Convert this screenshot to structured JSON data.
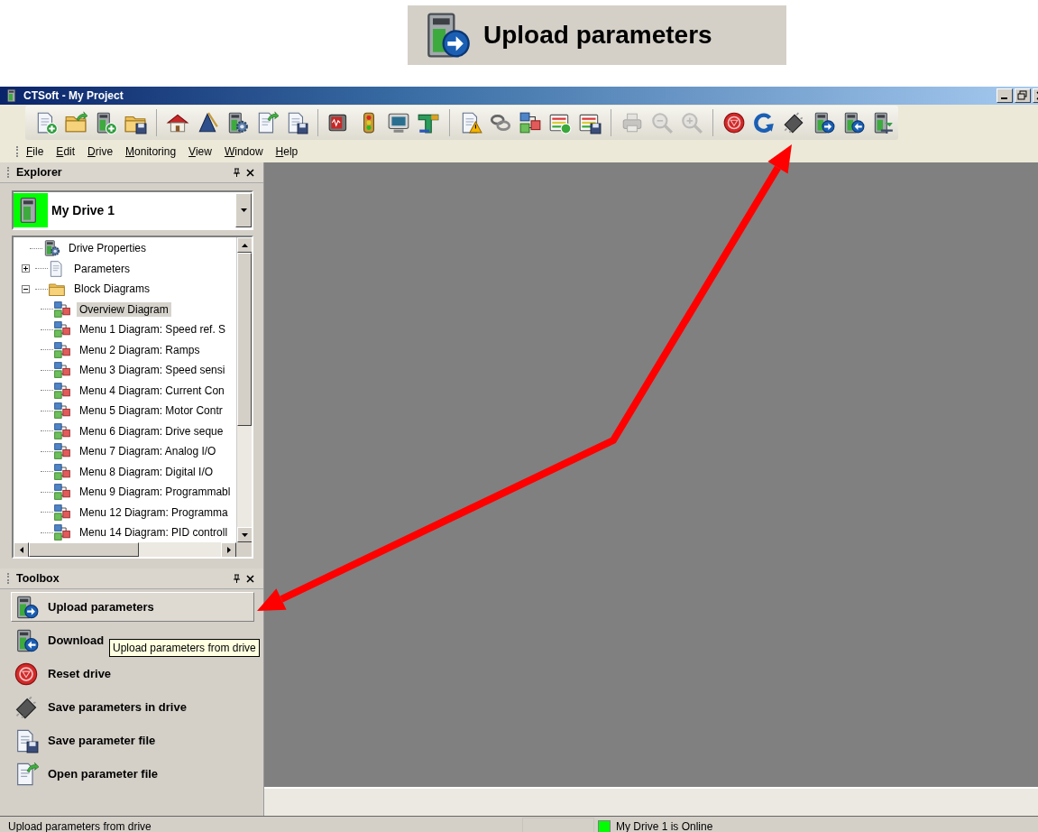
{
  "callout": {
    "text": "Upload parameters"
  },
  "window": {
    "title": "CTSoft - My Project"
  },
  "toolbar": {
    "groups": [
      [
        {
          "disabled": false
        },
        {
          "disabled": false
        },
        {
          "disabled": false
        },
        {
          "disabled": false
        }
      ],
      [
        {
          "disabled": false
        },
        {
          "disabled": false
        },
        {
          "disabled": false
        },
        {
          "disabled": false
        },
        {
          "disabled": false
        }
      ],
      [
        {
          "disabled": false
        },
        {
          "disabled": false
        },
        {
          "disabled": false
        },
        {
          "disabled": false
        }
      ],
      [
        {
          "disabled": false
        },
        {
          "disabled": false
        },
        {
          "disabled": false
        },
        {
          "disabled": false
        },
        {
          "disabled": false
        }
      ],
      [
        {
          "disabled": true
        },
        {
          "disabled": true
        },
        {
          "disabled": true
        }
      ],
      [
        {
          "disabled": false
        },
        {
          "disabled": false
        },
        {
          "disabled": false
        },
        {
          "disabled": false
        },
        {
          "disabled": false
        },
        {
          "disabled": false
        }
      ]
    ]
  },
  "menu": [
    "File",
    "Edit",
    "Drive",
    "Monitoring",
    "View",
    "Window",
    "Help"
  ],
  "explorer": {
    "title": "Explorer",
    "drive_selector": {
      "value": "My Drive 1",
      "online": true
    },
    "tree": [
      {
        "kind": "properties",
        "label": "Drive Properties",
        "selected": false
      },
      {
        "kind": "parameters",
        "label": "Parameters",
        "expanded": false,
        "selected": false
      },
      {
        "kind": "folder",
        "label": "Block Diagrams",
        "expanded": true,
        "selected": false,
        "children": [
          {
            "kind": "diagram",
            "label": "Overview Diagram",
            "selected": true
          },
          {
            "kind": "diagram",
            "label": "Menu 1 Diagram: Speed ref. S",
            "selected": false
          },
          {
            "kind": "diagram",
            "label": "Menu 2 Diagram: Ramps",
            "selected": false
          },
          {
            "kind": "diagram",
            "label": "Menu 3 Diagram: Speed sensi",
            "selected": false
          },
          {
            "kind": "diagram",
            "label": "Menu 4 Diagram: Current Con",
            "selected": false
          },
          {
            "kind": "diagram",
            "label": "Menu 5 Diagram: Motor Contr",
            "selected": false
          },
          {
            "kind": "diagram",
            "label": "Menu 6 Diagram: Drive seque",
            "selected": false
          },
          {
            "kind": "diagram",
            "label": "Menu 7 Diagram: Analog I/O",
            "selected": false
          },
          {
            "kind": "diagram",
            "label": "Menu 8 Diagram: Digital I/O",
            "selected": false
          },
          {
            "kind": "diagram",
            "label": "Menu 9 Diagram: Programmabl",
            "selected": false
          },
          {
            "kind": "diagram",
            "label": "Menu 12 Diagram: Programma",
            "selected": false
          },
          {
            "kind": "diagram",
            "label": "Menu 14 Diagram: PID controll",
            "selected": false
          }
        ]
      }
    ]
  },
  "toolbox": {
    "title": "Toolbox",
    "items": [
      {
        "kind": "upload",
        "label": "Upload parameters",
        "selected": true
      },
      {
        "kind": "download",
        "label": "Download",
        "selected": false
      },
      {
        "kind": "reset",
        "label": "Reset drive",
        "selected": false
      },
      {
        "kind": "chip",
        "label": "Save parameters in drive",
        "selected": false
      },
      {
        "kind": "save_file",
        "label": "Save parameter file",
        "selected": false
      },
      {
        "kind": "open_file",
        "label": "Open parameter file",
        "selected": false
      }
    ]
  },
  "tooltip": {
    "text": "Upload parameters from drive"
  },
  "status_bar": {
    "message": "Upload parameters from drive",
    "drive_status": {
      "text": "My Drive 1 is Online",
      "online": true
    }
  }
}
